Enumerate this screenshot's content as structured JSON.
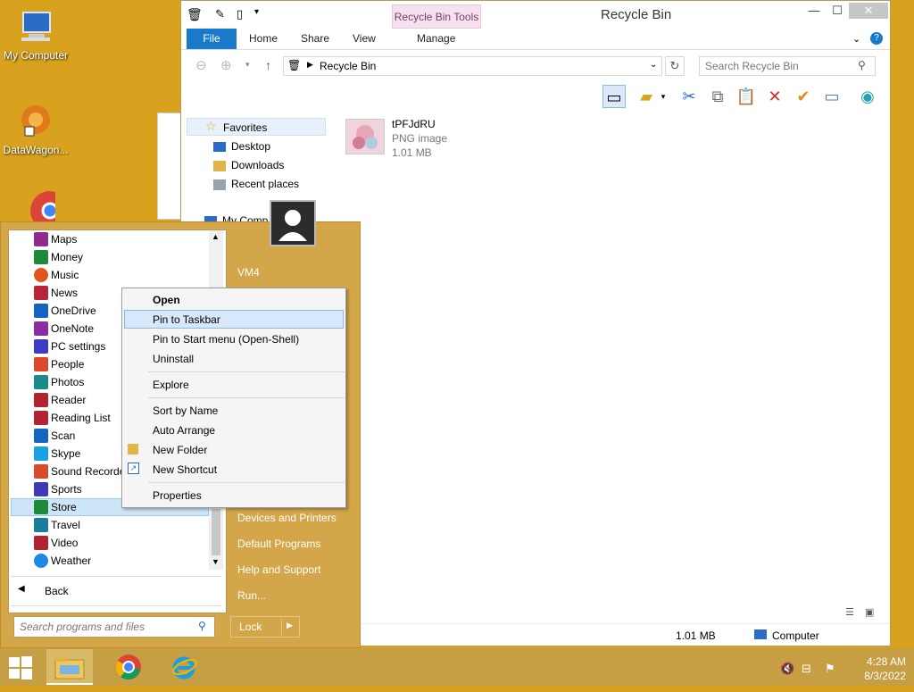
{
  "desktop": {
    "icons": [
      {
        "label": "My Computer",
        "icon": "computer-icon"
      },
      {
        "label": "DataWagon...",
        "icon": "datawagon-icon"
      },
      {
        "label": "",
        "icon": "chrome-icon"
      }
    ]
  },
  "explorer": {
    "window_title": "Recycle Bin",
    "context_tab": "Recycle Bin Tools",
    "controls": {
      "minimize": "—",
      "maximize": "☐",
      "close": "✕"
    },
    "ribbon_tabs": [
      "File",
      "Home",
      "Share",
      "View",
      "Manage"
    ],
    "address": "Recycle Bin",
    "search_placeholder": "Search Recycle Bin",
    "nav": {
      "favorites": "Favorites",
      "items": [
        "Desktop",
        "Downloads",
        "Recent places"
      ],
      "partial": "My Comp"
    },
    "file": {
      "name": "tPFJdRU",
      "type": "PNG image",
      "size": "1.01 MB"
    },
    "status": {
      "size": "1.01 MB",
      "location": "Computer"
    }
  },
  "startmenu": {
    "programs": [
      "Maps",
      "Money",
      "Music",
      "News",
      "OneDrive",
      "OneNote",
      "PC settings",
      "People",
      "Photos",
      "Reader",
      "Reading List",
      "Scan",
      "Skype",
      "Sound Recorder",
      "Sports",
      "Store",
      "Travel",
      "Video",
      "Weather"
    ],
    "selected_program": "Store",
    "back_label": "Back",
    "search_placeholder": "Search programs and files",
    "user_name": "VM4",
    "right_links": [
      "Devices and Printers",
      "Default Programs",
      "Help and Support",
      "Run..."
    ],
    "lock_label": "Lock"
  },
  "context_menu": {
    "items": [
      "Open",
      "Pin to Taskbar",
      "Pin to Start menu (Open-Shell)",
      "Uninstall",
      "Explore",
      "Sort by Name",
      "Auto Arrange",
      "New Folder",
      "New Shortcut",
      "Properties"
    ],
    "highlighted": "Pin to Taskbar"
  },
  "taskbar": {
    "time": "4:28 AM",
    "date": "8/3/2022"
  },
  "colors": {
    "desktop": "#d8a21e",
    "startmenu": "#d3a64a",
    "accent": "#1979ca"
  }
}
